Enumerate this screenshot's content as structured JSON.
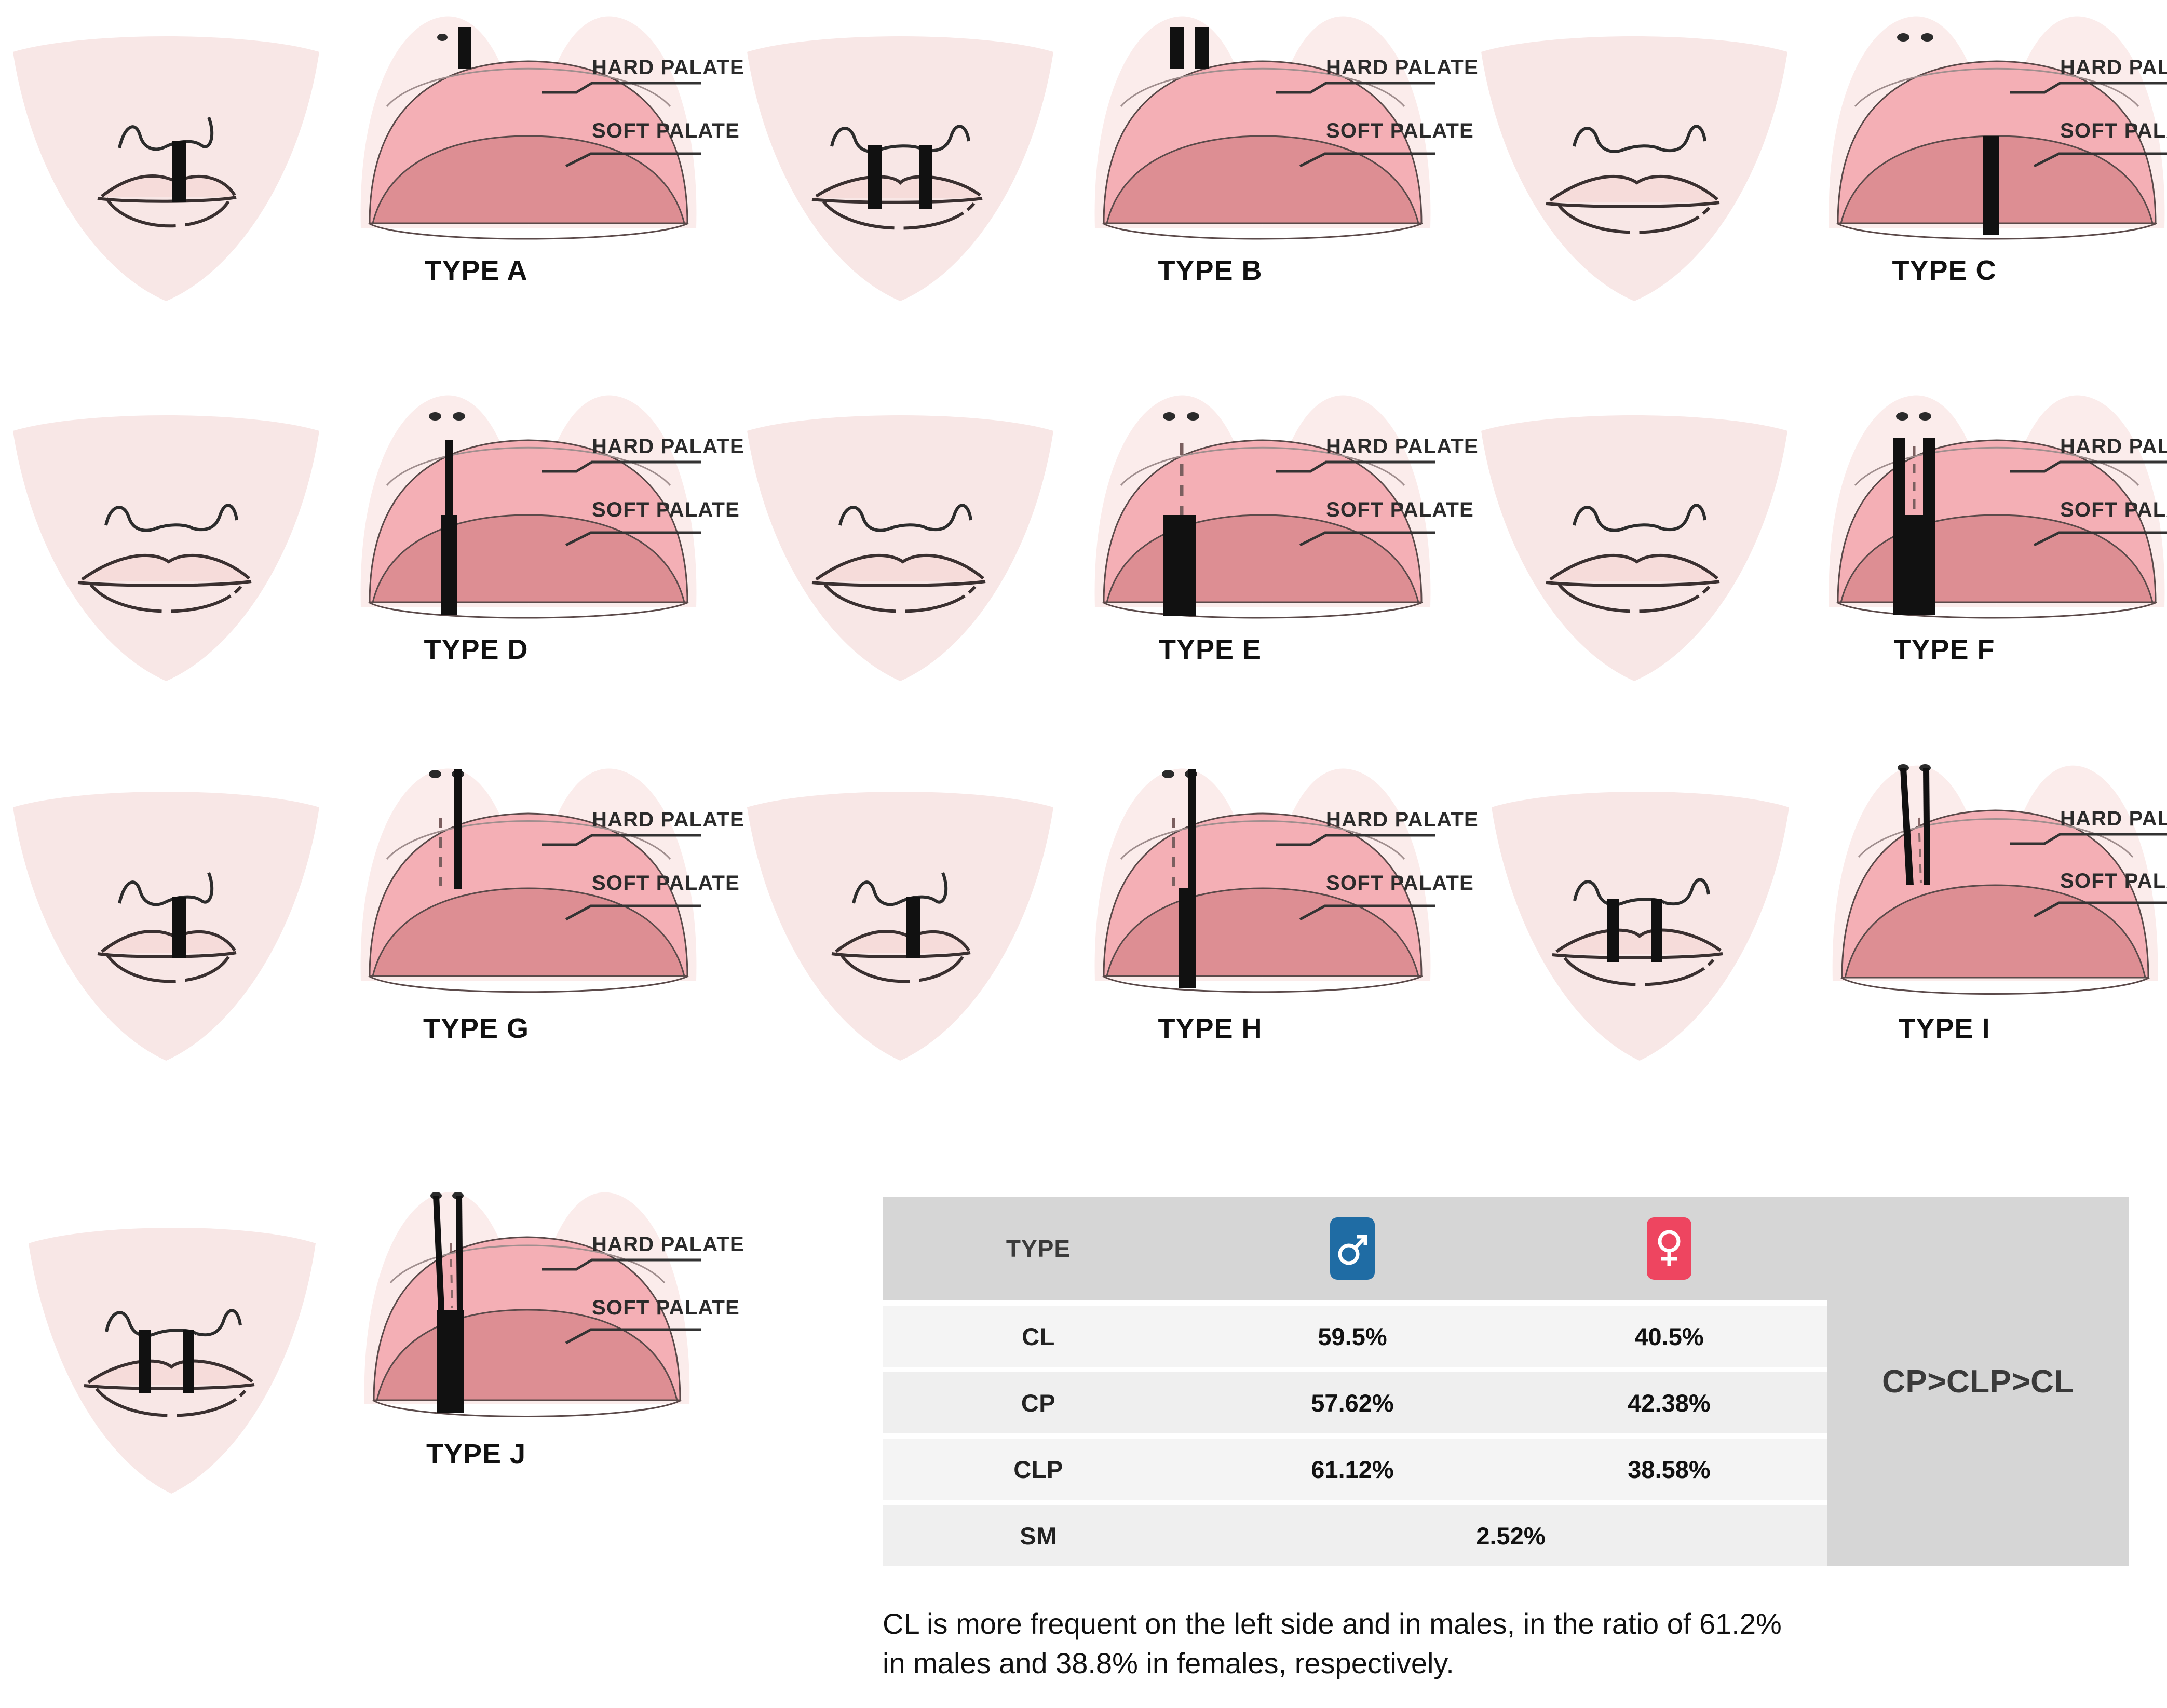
{
  "annotations": {
    "hard_palate": "HARD PALATE",
    "soft_palate": "SOFT PALATE"
  },
  "types": [
    {
      "label": "TYPE A",
      "face": "unilateral-cleft-lip-right",
      "palate": "alveolar-cleft-single"
    },
    {
      "label": "TYPE B",
      "face": "bilateral-cleft-lip",
      "palate": "alveolar-cleft-bilateral"
    },
    {
      "label": "TYPE C",
      "face": "intact-lip",
      "palate": "soft-palate-cleft"
    },
    {
      "label": "TYPE D",
      "face": "intact-lip",
      "palate": "hard-and-soft-palate-cleft"
    },
    {
      "label": "TYPE E",
      "face": "intact-lip",
      "palate": "submucous-hard-with-soft-palate-cleft"
    },
    {
      "label": "TYPE F",
      "face": "intact-lip",
      "palate": "bilateral-hard-and-soft-palate-cleft"
    },
    {
      "label": "TYPE G",
      "face": "unilateral-cleft-lip-right",
      "palate": "alveolus-and-hard-palate-cleft"
    },
    {
      "label": "TYPE H",
      "face": "unilateral-cleft-lip-right",
      "palate": "complete-unilateral-cleft"
    },
    {
      "label": "TYPE I",
      "face": "bilateral-cleft-lip",
      "palate": "bilateral-alveolus-hard-palate-cleft"
    },
    {
      "label": "TYPE J",
      "face": "bilateral-cleft-lip",
      "palate": "complete-bilateral-cleft"
    }
  ],
  "table": {
    "headers": {
      "type": "TYPE",
      "male_icon": "male-gender-icon",
      "female_icon": "female-gender-icon"
    },
    "rows": [
      {
        "type": "CL",
        "male": "59.5%",
        "female": "40.5%",
        "merged": null
      },
      {
        "type": "CP",
        "male": "57.62%",
        "female": "42.38%",
        "merged": null
      },
      {
        "type": "CLP",
        "male": "61.12%",
        "female": "38.58%",
        "merged": null
      },
      {
        "type": "SM",
        "male": null,
        "female": null,
        "merged": "2.52%"
      }
    ],
    "summary": "CP>CLP>CL"
  },
  "caption": "CL is more frequent on the left side and in males, in the ratio of 61.2% in males and 38.8% in females, respectively.",
  "colors": {
    "male_chip": "#1f6ca4",
    "female_chip": "#ee4560",
    "hard_palate": "#f4afb5",
    "soft_palate": "#dd8e93",
    "skin": "#f8e7e6",
    "header_bg": "#d6d6d6"
  }
}
